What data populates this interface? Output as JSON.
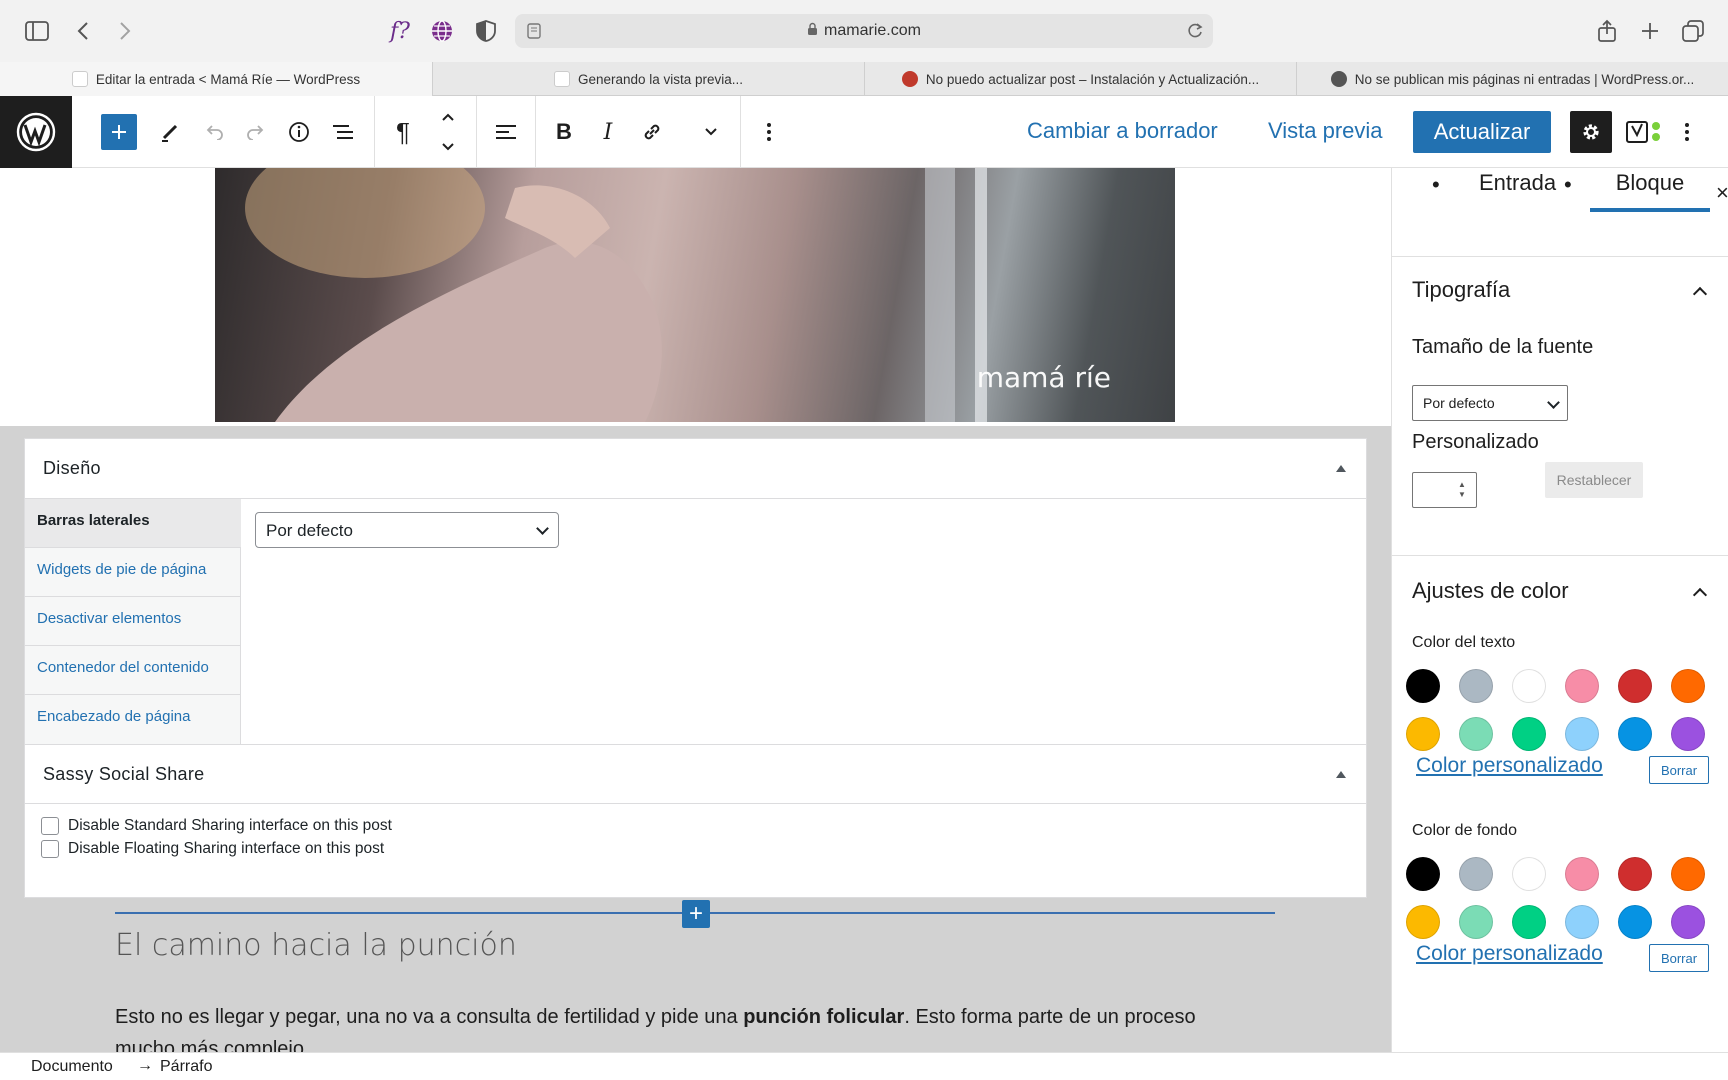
{
  "browser": {
    "address": "mamarie.com",
    "tabs": [
      {
        "label": "Editar la entrada < Mamá Ríe — WordPress",
        "active": true
      },
      {
        "label": "Generando la vista previa...",
        "active": false
      },
      {
        "label": "No puedo actualizar post – Instalación y Actualización...",
        "active": false
      },
      {
        "label": "No se publican mis páginas ni entradas | WordPress.or...",
        "active": false
      }
    ]
  },
  "toolbar": {
    "paragraph_icon": "¶",
    "bold": "B",
    "italic": "I",
    "switch_to_draft": "Cambiar a borrador",
    "preview": "Vista previa",
    "update": "Actualizar"
  },
  "image": {
    "watermark": "mamá ríe"
  },
  "metabox": {
    "design_title": "Diseño",
    "vertical_tabs": [
      "Barras laterales",
      "Widgets de pie de página",
      "Desactivar elementos",
      "Contenedor del contenido",
      "Encabezado de página"
    ],
    "sidebar_select_value": "Por defecto",
    "sassy_title": "Sassy Social Share",
    "checkbox_standard": "Disable Standard Sharing interface on this post",
    "checkbox_floating": "Disable Floating Sharing interface on this post"
  },
  "content": {
    "heading": "El camino hacia la punción",
    "paragraph_before": "Esto no es llegar y pegar, una no va a consulta de fertilidad y pide una ",
    "paragraph_bold": "punción folicular",
    "paragraph_after": ". Esto forma parte de un proceso",
    "paragraph_cut": "mucho más complejo."
  },
  "sidebar": {
    "tab_post": "Entrada",
    "tab_block": "Bloque",
    "close": "×",
    "typography_title": "Tipografía",
    "font_size_label": "Tamaño de la fuente",
    "font_size_select": "Por defecto",
    "custom_label": "Personalizado",
    "reset": "Restablecer",
    "color_title": "Ajustes de color",
    "text_color_label": "Color del texto",
    "bg_color_label": "Color de fondo",
    "custom_color": "Color personalizado",
    "clear": "Borrar",
    "palette": [
      "#000000",
      "#abb8c3",
      "#ffffff",
      "#f78da7",
      "#cf2e2e",
      "#ff6900",
      "#fcb900",
      "#7bdcb5",
      "#00d084",
      "#8ed1fc",
      "#0693e3",
      "#9b51e0"
    ]
  },
  "statusbar": {
    "document": "Documento",
    "arrow": "→",
    "paragraph": "Párrafo"
  }
}
